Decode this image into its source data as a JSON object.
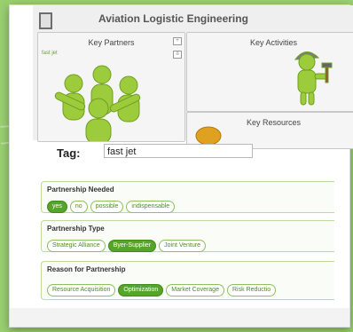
{
  "canvas": {
    "title": "Aviation Logistic Engineering",
    "boxes": {
      "key_partners": {
        "title": "Key Partners",
        "note": "fast jet"
      },
      "key_activities": {
        "title": "Key Activities"
      },
      "key_resources": {
        "title": "Key Resources"
      }
    }
  },
  "tag": {
    "label": "Tag:",
    "value": "fast jet"
  },
  "sections": [
    {
      "title": "Partnership Needed",
      "options": [
        "yes",
        "no",
        "possible",
        "indispensable"
      ],
      "selected": "yes"
    },
    {
      "title": "Partnership Type",
      "options": [
        "Strategic Alliance",
        "Byer-Supplier",
        "Joint Venture"
      ],
      "selected": "Byer-Supplier"
    },
    {
      "title": "Reason for Partnership",
      "options": [
        "Resource Acquisition",
        "Optimization",
        "Market Coverage",
        "Risk Reductio"
      ],
      "selected": "Optimization"
    }
  ],
  "colors": {
    "background": "#9bd070",
    "accent": "#56a42a",
    "figure": "#9ccc3c"
  }
}
